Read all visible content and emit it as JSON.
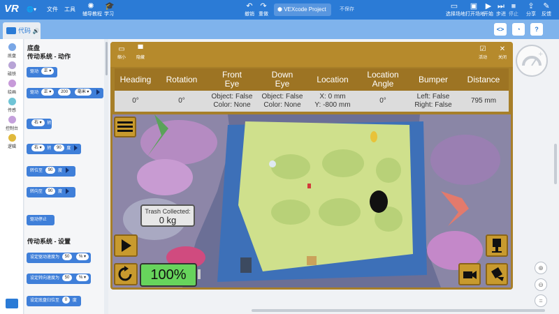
{
  "app": {
    "logo": "VR"
  },
  "menu": {
    "file": "文件",
    "tools": "工具"
  },
  "toolbar": {
    "tutorials": "辅导教程",
    "learn": "学习",
    "undo": "撤销",
    "redo": "重做",
    "project_name": "VEXcode Project",
    "unsaved": "不保存",
    "select_playground": "选择场地",
    "open_playground": "打开场地",
    "start": "开始",
    "step": "步进",
    "stop": "停止",
    "share": "分享",
    "feedback": "反馈"
  },
  "tabs": {
    "code": "代码"
  },
  "subbar_icons": [
    "code-view-icon",
    "dashboard-icon",
    "help-icon"
  ],
  "categories": [
    {
      "label": "底盘",
      "color": "#7aa7e6"
    },
    {
      "label": "磁铁",
      "color": "#b8a4d6"
    },
    {
      "label": "绘画",
      "color": "#c79ad9"
    },
    {
      "label": "传感",
      "color": "#6fc4d6"
    },
    {
      "label": "控制台",
      "color": "#c4a0dc"
    },
    {
      "label": "逻辑",
      "color": "#e0b93c"
    }
  ],
  "palette": {
    "title": "底盘",
    "section1": "传动系统 - 动作",
    "section2": "传动系统 - 设置",
    "blocks": {
      "drive": "驱动",
      "drive_dir": "正",
      "drive_for": "驱动",
      "drive_for_dir": "正",
      "drive_for_value": "200",
      "drive_for_unit": "毫米",
      "turn": "右",
      "turn_suffix": "转",
      "turn_for": "右",
      "turn_for_mid": "转",
      "turn_for_value": "90",
      "turn_for_unit": "度",
      "turn_to_heading": "转位至",
      "turn_to_heading_value": "90",
      "turn_to_heading_unit": "度",
      "turn_to_rotation": "转向至",
      "turn_to_rotation_value": "90",
      "turn_to_rotation_unit": "度",
      "stop": "驱动停止",
      "set_drive_velocity": "设定驱动速度为",
      "set_drive_velocity_value": "50",
      "set_drive_velocity_unit": "%",
      "set_turn_velocity": "设定转向速度为",
      "set_turn_velocity_value": "50",
      "set_turn_velocity_unit": "%",
      "set_heading": "设定底盘归位至",
      "set_heading_value": "0",
      "set_heading_unit": "度"
    }
  },
  "sim": {
    "shrink": "缩小",
    "hide": "隐藏",
    "move": "活动",
    "close": "关闭",
    "telemetry": {
      "headers": [
        "Heading",
        "Rotation",
        "Front Eye",
        "Down Eye",
        "Location",
        "Location Angle",
        "Bumper",
        "Distance"
      ],
      "values": [
        "0°",
        "0°",
        "Object: False\nColor: None",
        "Object: False\nColor: None",
        "X: 0 mm\nY: -800 mm",
        "0°",
        "Left: False\nRight: False",
        "795 mm"
      ]
    },
    "trash_label": "Trash Collected:",
    "trash_value": "0 kg",
    "progress_label": "100%",
    "progress": 1.0
  },
  "colors": {
    "brand": "#2b7bd6",
    "sim_gold": "#b68a2c",
    "block_blue": "#3f7fd9",
    "progress_green": "#67d45c"
  }
}
